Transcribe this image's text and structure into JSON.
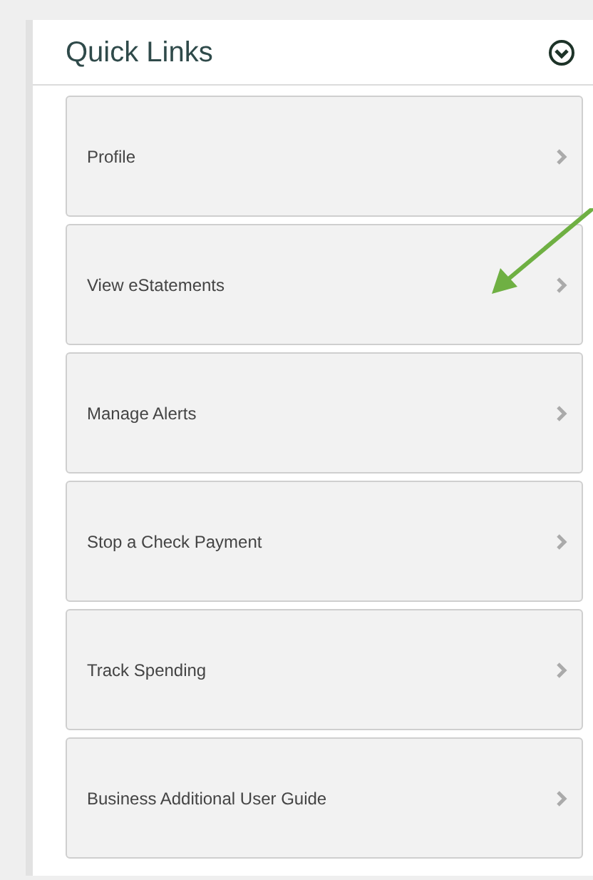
{
  "panel": {
    "title": "Quick Links",
    "expanded": true
  },
  "links": [
    {
      "label": "Profile"
    },
    {
      "label": "View eStatements"
    },
    {
      "label": "Manage Alerts"
    },
    {
      "label": "Stop a Check Payment"
    },
    {
      "label": "Track Spending"
    },
    {
      "label": "Business Additional User Guide"
    }
  ]
}
